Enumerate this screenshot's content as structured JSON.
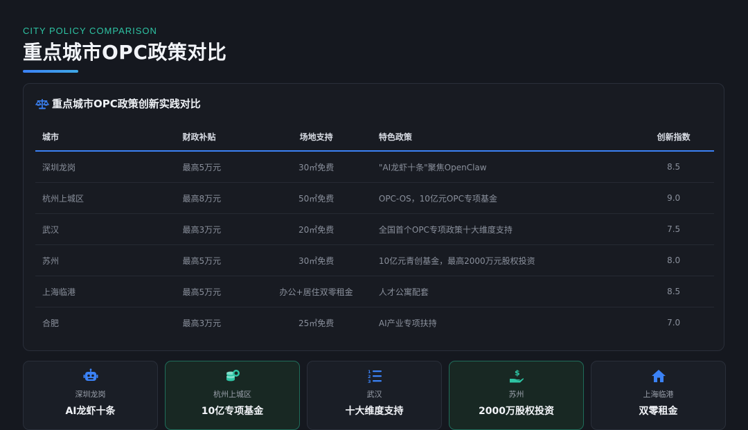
{
  "header": {
    "eyebrow": "CITY POLICY COMPARISON",
    "title": "重点城市OPC政策对比"
  },
  "panel": {
    "title": "重点城市OPC政策创新实践对比",
    "icon": "scale-icon",
    "columns": [
      "城市",
      "财政补贴",
      "场地支持",
      "特色政策",
      "创新指数"
    ],
    "rows": [
      {
        "city": "深圳龙岗",
        "subsidy": "最高5万元",
        "site": "30㎡免费",
        "feature": "\"AI龙虾十条\"聚焦OpenClaw",
        "index": "8.5"
      },
      {
        "city": "杭州上城区",
        "subsidy": "最高8万元",
        "site": "50㎡免费",
        "feature": "OPC-OS，10亿元OPC专项基金",
        "index": "9.0"
      },
      {
        "city": "武汉",
        "subsidy": "最高3万元",
        "site": "20㎡免费",
        "feature": "全国首个OPC专项政策十大维度支持",
        "index": "7.5"
      },
      {
        "city": "苏州",
        "subsidy": "最高5万元",
        "site": "30㎡免费",
        "feature": "10亿元青创基金，最高2000万元股权投资",
        "index": "8.0"
      },
      {
        "city": "上海临港",
        "subsidy": "最高5万元",
        "site": "办公+居住双零租金",
        "feature": "人才公寓配套",
        "index": "8.5"
      },
      {
        "city": "合肥",
        "subsidy": "最高3万元",
        "site": "25㎡免费",
        "feature": "AI产业专项扶持",
        "index": "7.0"
      }
    ]
  },
  "cards": [
    {
      "icon": "robot-icon",
      "city": "深圳龙岗",
      "value": "AI龙虾十条",
      "accent": "#3b82f6",
      "style": "dark"
    },
    {
      "icon": "coins-icon",
      "city": "杭州上城区",
      "value": "10亿专项基金",
      "accent": "#2ec4a4",
      "style": "teal"
    },
    {
      "icon": "numbered-list-icon",
      "city": "武汉",
      "value": "十大维度支持",
      "accent": "#3b82f6",
      "style": "dark"
    },
    {
      "icon": "hand-money-icon",
      "city": "苏州",
      "value": "2000万股权投资",
      "accent": "#2ec4a4",
      "style": "teal"
    },
    {
      "icon": "home-icon",
      "city": "上海临港",
      "value": "双零租金",
      "accent": "#3b82f6",
      "style": "dark"
    }
  ]
}
